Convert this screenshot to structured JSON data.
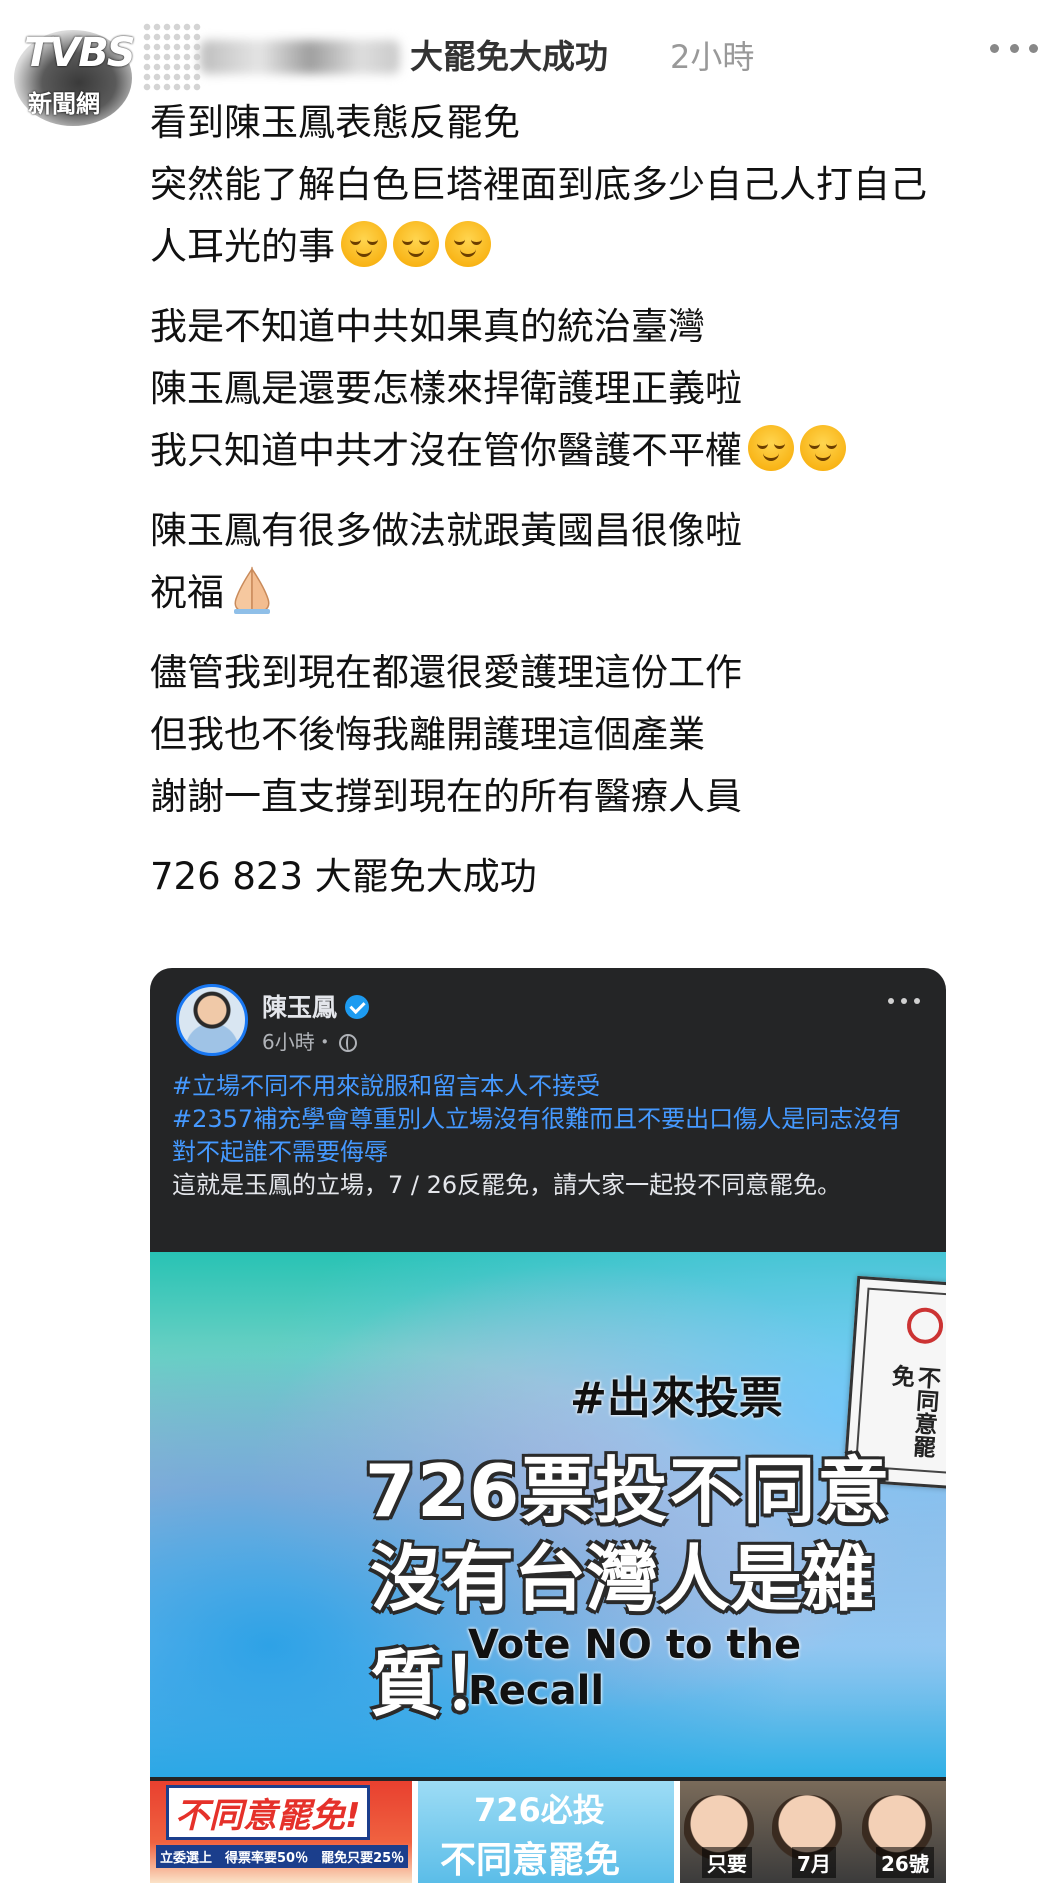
{
  "watermark": {
    "logo": "TVBS",
    "sub": "新聞網"
  },
  "header": {
    "title": "大罷免大成功",
    "time": "2小時"
  },
  "post": {
    "p1": [
      "看到陳玉鳳表態反罷免",
      "突然能了解白色巨塔裡面到底多少自己人打自己",
      "人耳光的事"
    ],
    "p2": [
      "我是不知道中共如果真的統治臺灣",
      "陳玉鳳是還要怎樣來捍衛護理正義啦",
      "我只知道中共才沒在管你醫護不平權"
    ],
    "p3": [
      "陳玉鳳有很多做法就跟黃國昌很像啦",
      "祝福"
    ],
    "p4": [
      "儘管我到現在都還很愛護理這份工作",
      "但我也不後悔我離開護理這個產業",
      "謝謝一直支撐到現在的所有醫療人員"
    ],
    "p5": "726 823 大罷免大成功",
    "emoji_relieved": "relieved-face-icon",
    "emoji_pray": "folded-hands-icon"
  },
  "card": {
    "name": "陳玉鳳",
    "meta": "6小時・",
    "tag1": "#立場不同不用來說服和留言本人不接受",
    "tag2": "#2357補充學會尊重別人立場沒有很難而且不要出口傷人是同志沒有對不起誰不需要侮辱",
    "text": "這就是玉鳳的立場，7 / 26反罷免，請大家一起投不同意罷免。",
    "banner": {
      "tag": "#出來投票",
      "line1": "726票投不同意",
      "line2": "沒有台灣人是雜質！",
      "line3": "Vote NO to the Recall",
      "ballot": "不同意罷免"
    },
    "thumbs": {
      "t1_title": "不同意罷免!",
      "t1_row": "立委選上　得票率要50％　罷免只要25％",
      "t2_a": "726必投",
      "t2_b": "不同意罷免",
      "t3_labels": [
        "只要",
        "7月",
        "26號"
      ]
    }
  }
}
